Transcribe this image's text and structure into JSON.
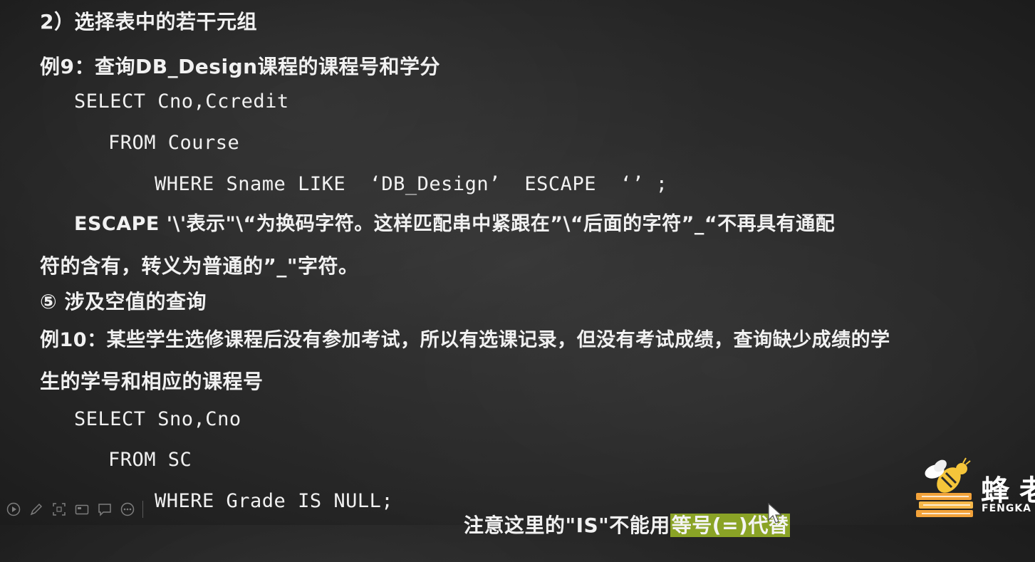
{
  "slide": {
    "heading": "2）选择表中的若干元组",
    "example9": {
      "title": "例9：查询DB_Design课程的课程号和学分",
      "sql_select": "SELECT Cno,Ccredit",
      "sql_from": "FROM Course",
      "sql_where": "WHERE Sname LIKE  ‘DB_Design’  ESCAPE  ‘’ ;"
    },
    "escape_note": {
      "line1": "ESCAPE '\\'表示\"\\“为换码字符。这样匹配串中紧跟在”\\“后面的字符”_“不再具有通配",
      "line2": "符的含有，转义为普通的”_\"字符。"
    },
    "section5": {
      "title": "⑤ 涉及空值的查询"
    },
    "example10": {
      "title_line1": "例10：某些学生选修课程后没有参加考试，所以有选课记录，但没有考试成绩，查询缺少成绩的学",
      "title_line2": "生的学号和相应的课程号",
      "sql_select": "SELECT Sno,Cno",
      "sql_from": "FROM SC",
      "sql_where": "WHERE Grade IS NULL;",
      "note_prefix": "注意这里的\"IS\"不能用",
      "note_highlight": "等号(=)代替"
    }
  },
  "logo": {
    "text": "蜂",
    "text_partial": "老",
    "subtitle": "FENGKA"
  },
  "toolbar": {
    "icons": [
      "play-icon",
      "pen-icon",
      "screenshot-icon",
      "camera-icon",
      "comment-icon",
      "more-icon"
    ]
  },
  "colors": {
    "background": "#2b2b2b",
    "text": "#f1f1f1",
    "highlight": "#8aa326"
  }
}
